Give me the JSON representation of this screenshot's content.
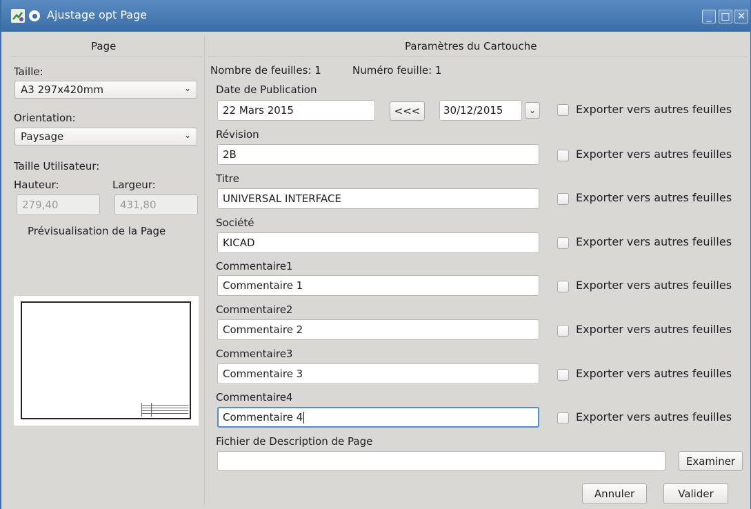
{
  "window": {
    "title": "Ajustage opt Page",
    "controls": {
      "minimize": "_",
      "maximize": "□",
      "close": "✕"
    }
  },
  "left": {
    "title": "Page",
    "size_label": "Taille:",
    "size_value": "A3 297x420mm",
    "orientation_label": "Orientation:",
    "orientation_value": "Paysage",
    "user_size_label": "Taille Utilisateur:",
    "height_label": "Hauteur:",
    "width_label": "Largeur:",
    "height_value": "279,40",
    "width_value": "431,80",
    "preview_label": "Prévisualisation de la Page"
  },
  "right": {
    "title": "Paramètres du Cartouche",
    "sheet_count": "Nombre de feuilles: 1",
    "sheet_number": "Numéro feuille: 1",
    "export_label": "Exporter vers autres feuilles",
    "date_label": "Date de Publication",
    "date_value": "22 Mars 2015",
    "copy_date_btn": "<<<",
    "date_picker_value": "30/12/2015",
    "revision_label": "Révision",
    "revision_value": "2B",
    "title_label": "Titre",
    "title_value": "UNIVERSAL INTERFACE",
    "company_label": "Société",
    "company_value": "KICAD",
    "comments": [
      {
        "label": "Commentaire1",
        "value": "Commentaire 1"
      },
      {
        "label": "Commentaire2",
        "value": "Commentaire 2"
      },
      {
        "label": "Commentaire3",
        "value": "Commentaire 3"
      },
      {
        "label": "Commentaire4",
        "value": "Commentaire 4"
      }
    ],
    "page_desc_label": "Fichier de Description de Page",
    "page_desc_value": "",
    "browse_btn": "Examiner"
  },
  "footer": {
    "cancel_btn": "Annuler",
    "ok_btn": "Valider"
  },
  "colors": {
    "titlebar": "#3b6ea5",
    "window_bg": "#d9d8d5",
    "focus": "#4f8ed1"
  }
}
